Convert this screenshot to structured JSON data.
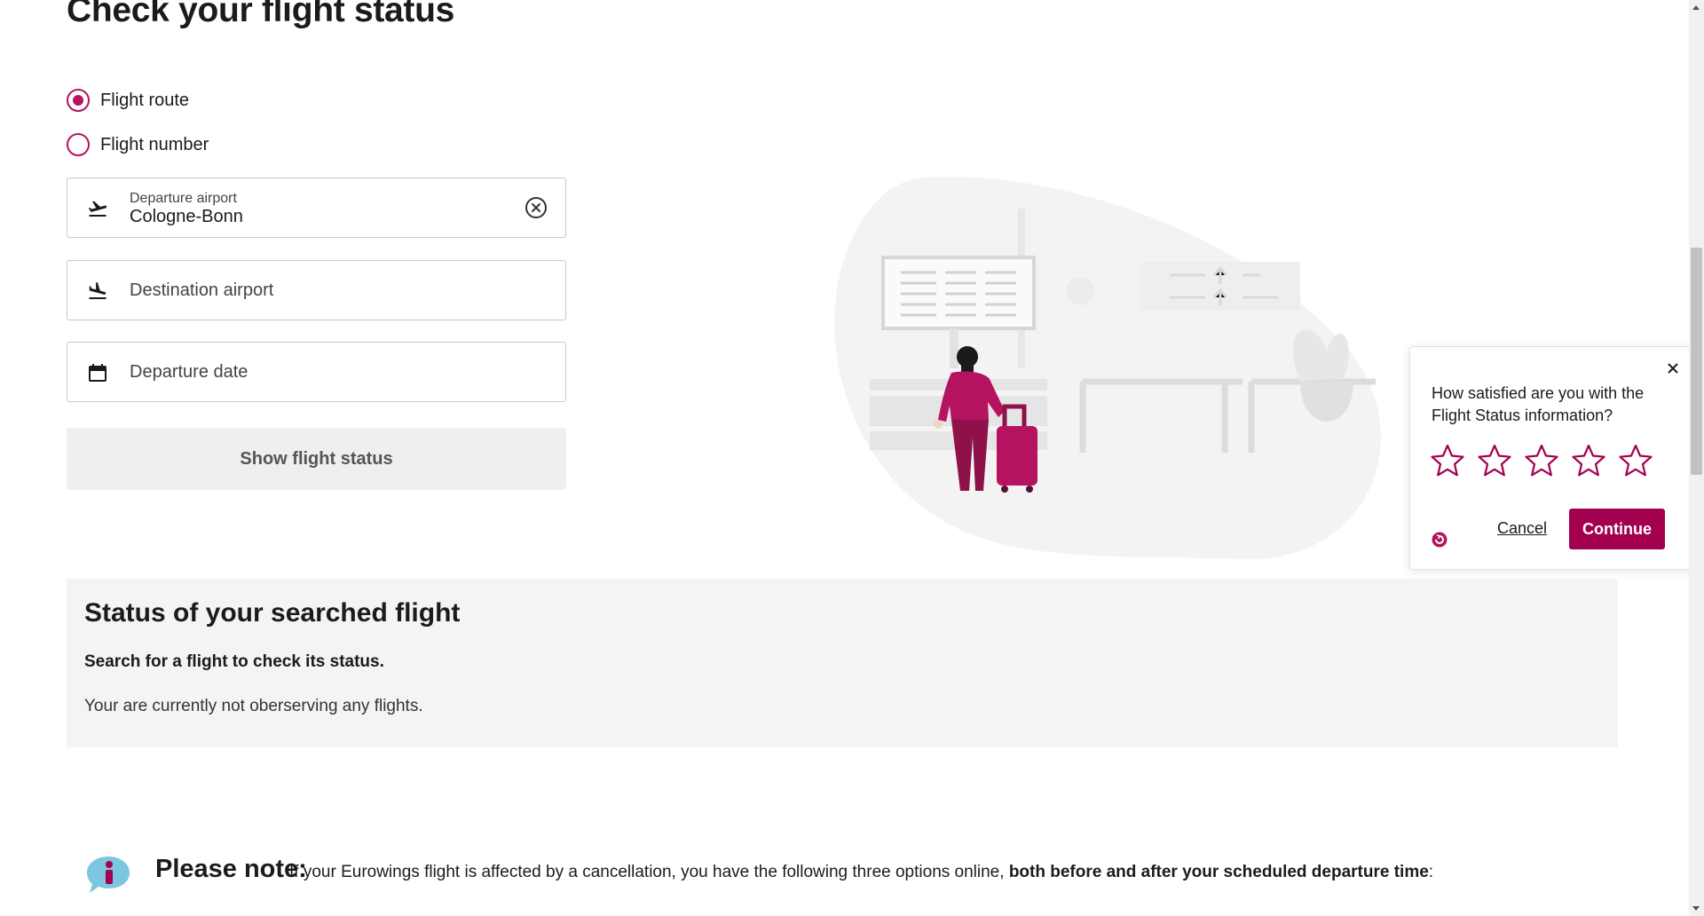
{
  "page": {
    "title": "Check your flight status"
  },
  "search": {
    "mode_options": [
      {
        "label": "Flight route",
        "checked": true
      },
      {
        "label": "Flight number",
        "checked": false
      }
    ],
    "departure": {
      "label": "Departure airport",
      "value": "Cologne-Bonn"
    },
    "destination": {
      "placeholder": "Destination airport"
    },
    "date": {
      "placeholder": "Departure date"
    },
    "submit_label": "Show flight status"
  },
  "status": {
    "title": "Status of your searched flight",
    "subtitle": "Search for a flight to check its status.",
    "note": "Your are currently not oberserving any flights."
  },
  "notice": {
    "heading": "Please note:",
    "text_before": "If your Eurowings flight is affected by a cancellation, you have the following three options online,",
    "text_bold": "both before and after your scheduled departure time",
    "text_after": ":"
  },
  "survey": {
    "question": "How satisfied are you with the Flight Status information?",
    "rating_max": 5,
    "rating_value": 0,
    "cancel_label": "Cancel",
    "continue_label": "Continue"
  },
  "colors": {
    "brand": "#b5135f",
    "continue_button": "#a3004f",
    "status_background": "#f4f4f4",
    "illustration_blob": "#f3f3f4"
  },
  "icons": [
    "plane-takeoff-icon",
    "plane-landing-icon",
    "calendar-icon",
    "clear-icon",
    "close-icon",
    "star-icon",
    "info-bubble-icon",
    "feedback-logo-icon"
  ]
}
